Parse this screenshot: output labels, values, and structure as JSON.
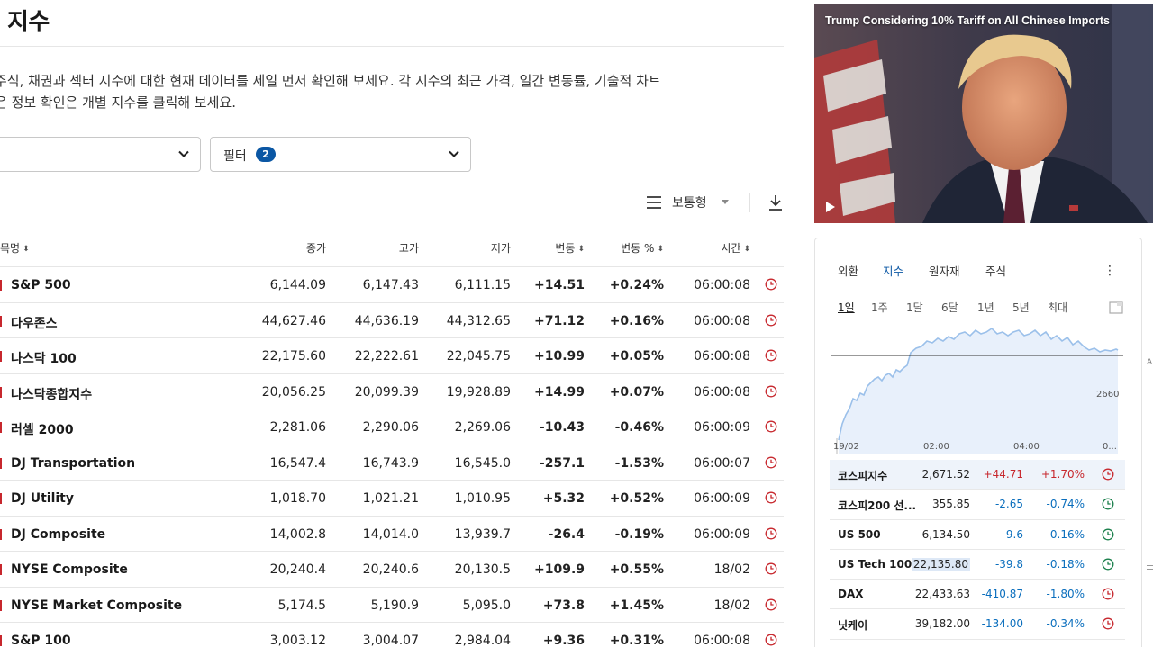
{
  "page": {
    "title": "지수",
    "description_line1": "주식, 채권과 섹터 지수에 대한 현재 데이터를 제일 먼저 확인해 보세요. 각 지수의 최근 가격, 일간 변동률, 기술적 차트",
    "description_line2": "은 정보 확인은 개별 지수를 클릭해 보세요."
  },
  "filters": {
    "dropdown1_value": "",
    "filter_label": "필터",
    "filter_count": "2"
  },
  "toolbar": {
    "view_label": "보통형"
  },
  "table": {
    "headers": {
      "name": "목명",
      "close": "종가",
      "high": "고가",
      "low": "저가",
      "change": "변동",
      "change_pct": "변동 %",
      "time": "시간"
    },
    "rows": [
      {
        "name": "S&P 500",
        "close": "6,144.09",
        "high": "6,147.43",
        "low": "6,111.15",
        "change": "+14.51",
        "change_pct": "+0.24%",
        "time": "06:00:08",
        "dir": "pos"
      },
      {
        "name": "다우존스",
        "close": "44,627.46",
        "high": "44,636.19",
        "low": "44,312.65",
        "change": "+71.12",
        "change_pct": "+0.16%",
        "time": "06:00:08",
        "dir": "pos"
      },
      {
        "name": "나스닥 100",
        "close": "22,175.60",
        "high": "22,222.61",
        "low": "22,045.75",
        "change": "+10.99",
        "change_pct": "+0.05%",
        "time": "06:00:08",
        "dir": "pos"
      },
      {
        "name": "나스닥종합지수",
        "close": "20,056.25",
        "high": "20,099.39",
        "low": "19,928.89",
        "change": "+14.99",
        "change_pct": "+0.07%",
        "time": "06:00:08",
        "dir": "pos"
      },
      {
        "name": "러셀 2000",
        "close": "2,281.06",
        "high": "2,290.06",
        "low": "2,269.06",
        "change": "-10.43",
        "change_pct": "-0.46%",
        "time": "06:00:09",
        "dir": "neg"
      },
      {
        "name": "DJ Transportation",
        "close": "16,547.4",
        "high": "16,743.9",
        "low": "16,545.0",
        "change": "-257.1",
        "change_pct": "-1.53%",
        "time": "06:00:07",
        "dir": "neg"
      },
      {
        "name": "DJ Utility",
        "close": "1,018.70",
        "high": "1,021.21",
        "low": "1,010.95",
        "change": "+5.32",
        "change_pct": "+0.52%",
        "time": "06:00:09",
        "dir": "pos"
      },
      {
        "name": "DJ Composite",
        "close": "14,002.8",
        "high": "14,014.0",
        "low": "13,939.7",
        "change": "-26.4",
        "change_pct": "-0.19%",
        "time": "06:00:09",
        "dir": "neg"
      },
      {
        "name": "NYSE Composite",
        "close": "20,240.4",
        "high": "20,240.6",
        "low": "20,130.5",
        "change": "+109.9",
        "change_pct": "+0.55%",
        "time": "18/02",
        "dir": "pos"
      },
      {
        "name": "NYSE Market Composite",
        "close": "5,174.5",
        "high": "5,190.9",
        "low": "5,095.0",
        "change": "+73.8",
        "change_pct": "+1.45%",
        "time": "18/02",
        "dir": "pos"
      },
      {
        "name": "S&P 100",
        "close": "3,003.12",
        "high": "3,004.07",
        "low": "2,984.04",
        "change": "+9.36",
        "change_pct": "+0.31%",
        "time": "06:00:08",
        "dir": "pos"
      }
    ]
  },
  "video": {
    "title": "Trump Considering 10% Tariff on All Chinese Imports"
  },
  "widget": {
    "tabs": [
      "외환",
      "지수",
      "원자재",
      "주식"
    ],
    "active_tab": 1,
    "ranges": [
      "1일",
      "1주",
      "1달",
      "6달",
      "1년",
      "5년",
      "최대"
    ],
    "active_range": 0,
    "chart": {
      "price_label": "2660",
      "x_labels": [
        "19/02",
        "02:00",
        "04:00",
        "0..."
      ]
    },
    "rows": [
      {
        "name": "코스피지수",
        "value": "2,671.52",
        "change": "+44.71",
        "pct": "+1.70%",
        "dir": "pos",
        "clock": "red"
      },
      {
        "name": "코스피200 선...",
        "value": "355.85",
        "change": "-2.65",
        "pct": "-0.74%",
        "dir": "neg",
        "clock": "green"
      },
      {
        "name": "US 500",
        "value": "6,134.50",
        "change": "-9.6",
        "pct": "-0.16%",
        "dir": "neg",
        "clock": "green"
      },
      {
        "name": "US Tech 100",
        "value": "22,135.80",
        "change": "-39.8",
        "pct": "-0.18%",
        "dir": "neg",
        "clock": "green"
      },
      {
        "name": "DAX",
        "value": "22,433.63",
        "change": "-410.87",
        "pct": "-1.80%",
        "dir": "neg",
        "clock": "red"
      },
      {
        "name": "닛케이",
        "value": "39,182.00",
        "change": "-134.00",
        "pct": "-0.34%",
        "dir": "neg",
        "clock": "red"
      }
    ]
  },
  "colors": {
    "positive": "#c7272d",
    "negative": "#0a6ebd",
    "accent": "#0b57a4",
    "clock_green": "#1a7f4b"
  }
}
